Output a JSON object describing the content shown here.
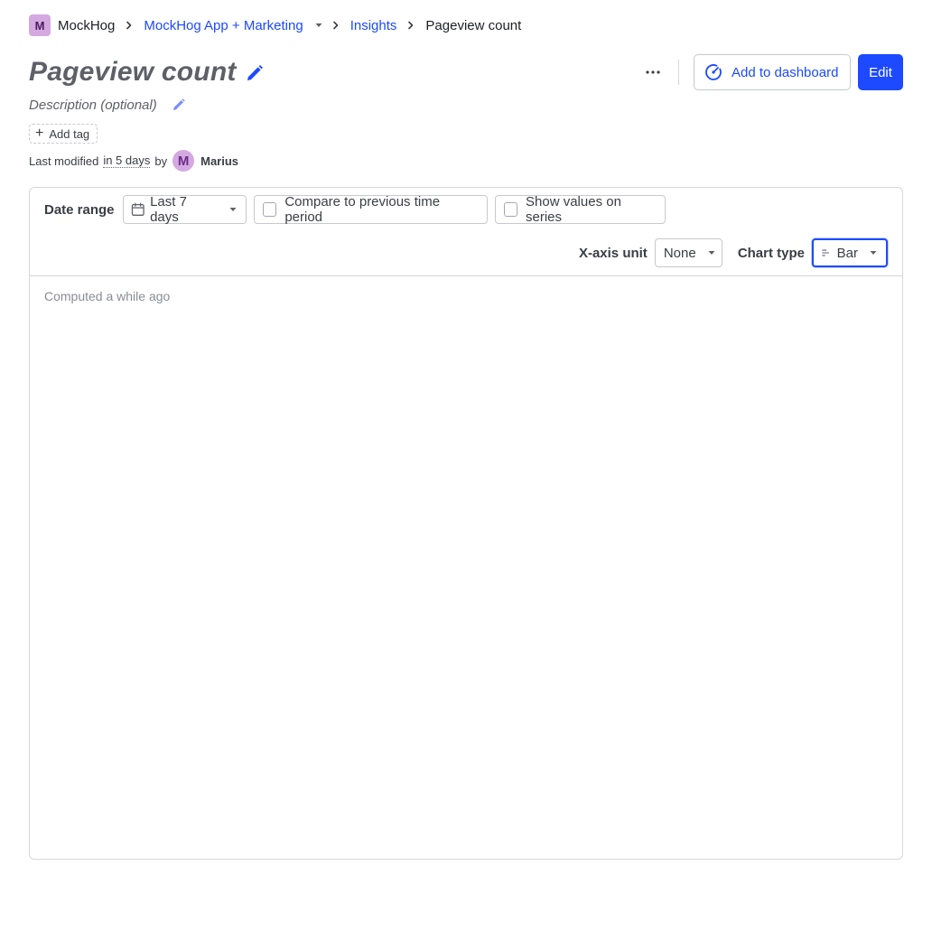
{
  "breadcrumb": {
    "org_initial": "M",
    "org_name": "MockHog",
    "project": "MockHog App + Marketing",
    "section": "Insights",
    "current": "Pageview count"
  },
  "insight": {
    "title": "Pageview count",
    "description_placeholder": "Description (optional)",
    "add_tag_label": "Add tag",
    "modified_prefix": "Last modified",
    "modified_when": "in 5 days",
    "modified_by_word": "by",
    "user_initial": "M",
    "user_name": "Marius"
  },
  "actions": {
    "add_to_dashboard": "Add to dashboard",
    "edit": "Edit"
  },
  "filters": {
    "date_range_label": "Date range",
    "date_range_value": "Last 7 days",
    "compare_label": "Compare to previous time period",
    "compare_checked": false,
    "show_values_label": "Show values on series",
    "show_values_checked": false,
    "x_axis_label": "X-axis unit",
    "x_axis_value": "None",
    "chart_type_label": "Chart type",
    "chart_type_value": "Bar"
  },
  "status": {
    "computed": "Computed a while ago"
  },
  "colors": {
    "primary": "#1d4aff",
    "avatar_bg": "#d4a8e0",
    "muted_text": "#8a8c94",
    "border": "#d6d7dc"
  }
}
